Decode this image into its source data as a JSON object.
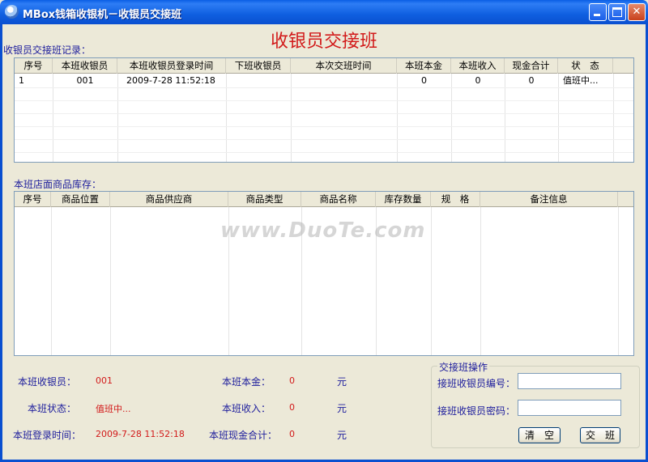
{
  "window": {
    "title": "MBox钱箱收银机－收银员交接班"
  },
  "heading": "收银员交接班",
  "shift_records": {
    "label": "收银员交接班记录：",
    "columns": [
      "序号",
      "本班收银员",
      "本班收银员登录时间",
      "下班收银员",
      "本次交班时间",
      "本班本金",
      "本班收入",
      "现金合计",
      "状　态"
    ],
    "rows": [
      {
        "no": "1",
        "cashier": "001",
        "login_time": "2009-7-28 11:52:18",
        "next_cashier": "",
        "handover_time": "",
        "principal": "0",
        "income": "0",
        "cash_total": "0",
        "status": "值班中..."
      }
    ]
  },
  "inventory": {
    "label": "本班店面商品库存：",
    "columns": [
      "序号",
      "商品位置",
      "商品供应商",
      "商品类型",
      "商品名称",
      "库存数量",
      "规　格",
      "备注信息"
    ]
  },
  "summary": {
    "cashier_label": "本班收银员：",
    "cashier_value": "001",
    "status_label": "本班状态：",
    "status_value": "值班中...",
    "login_label": "本班登录时间：",
    "login_value": "2009-7-28 11:52:18",
    "principal_label": "本班本金：",
    "principal_value": "0",
    "principal_unit": "元",
    "income_label": "本班收入：",
    "income_value": "0",
    "income_unit": "元",
    "cash_total_label": "本班现金合计：",
    "cash_total_value": "0",
    "cash_total_unit": "元"
  },
  "handover": {
    "title": "交接班操作",
    "id_label": "接班收银员编号：",
    "id_value": "",
    "pwd_label": "接班收银员密码：",
    "pwd_value": "",
    "clear_label": "清　空",
    "submit_label": "交　班"
  },
  "watermark": "www.DuoTe.com",
  "colors": {
    "titlebar": "#0a5ee4",
    "heading": "#d21a1a",
    "label": "#1c1c9c",
    "value": "#d21a1a",
    "background": "#ece9d8"
  }
}
